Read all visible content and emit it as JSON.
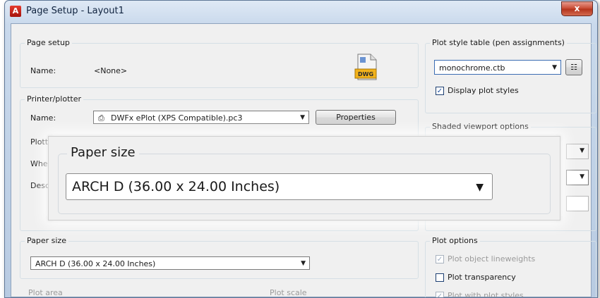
{
  "window": {
    "app_icon": "autocad-a-icon",
    "title": "Page Setup - Layout1",
    "close_label": "x"
  },
  "page_setup": {
    "group_label": "Page setup",
    "name_label": "Name:",
    "name_value": "<None>",
    "dwg_badge": "DWG"
  },
  "printer": {
    "group_label": "Printer/plotter",
    "name_label": "Name:",
    "selected_printer": "DWFx ePlot (XPS Compatible).pc3",
    "properties_label": "Properties",
    "plotter_label_partial": "Plott",
    "where_label_partial": "Whe",
    "description_label_partial": "Desc"
  },
  "plot_style_table": {
    "group_label": "Plot style table (pen assignments)",
    "selected": "monochrome.ctb",
    "display_plot_styles_label": "Display plot styles",
    "display_plot_styles_checked": true
  },
  "shaded_viewport": {
    "group_label": "Shaded viewport options"
  },
  "callout": {
    "label": "Paper size",
    "selected": "ARCH D (36.00 x 24.00 Inches)"
  },
  "paper_size": {
    "group_label": "Paper size",
    "selected": "ARCH D (36.00 x 24.00 Inches)"
  },
  "plot_options": {
    "group_label": "Plot options",
    "items": [
      {
        "label": "Plot object lineweights",
        "checked": true,
        "enabled": false
      },
      {
        "label": "Plot transparency",
        "checked": false,
        "enabled": true
      },
      {
        "label": "Plot with plot styles",
        "checked": true,
        "enabled": false
      }
    ]
  },
  "partial_labels": {
    "plot_area": "Plot area",
    "plot_scale": "Plot scale"
  }
}
